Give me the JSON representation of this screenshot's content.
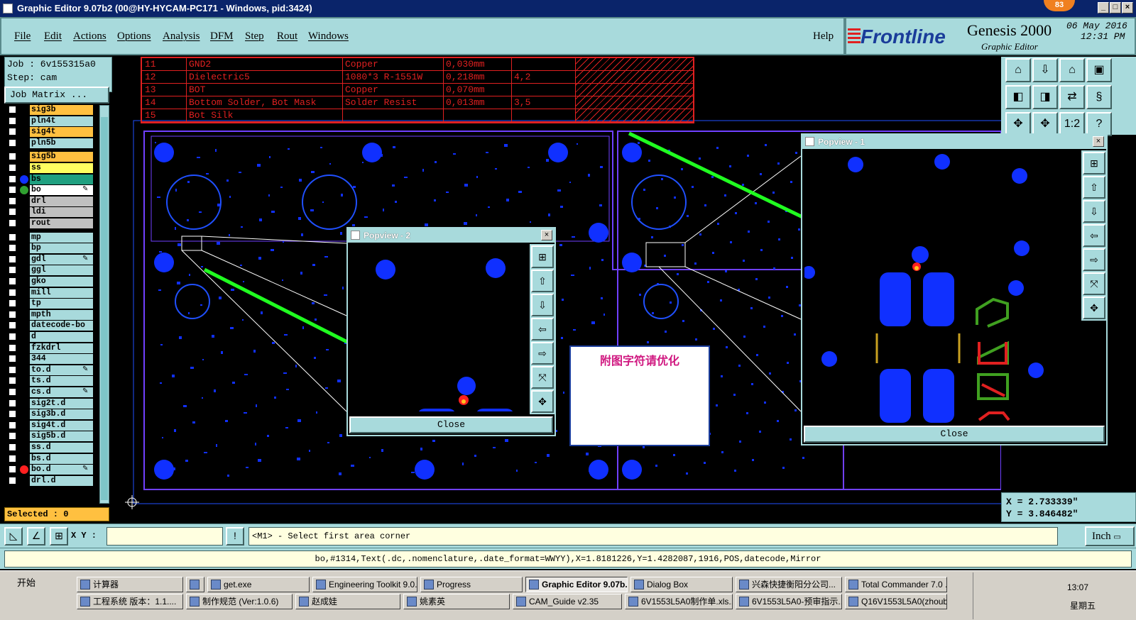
{
  "window": {
    "title": "Graphic Editor 9.07b2 (00@HY-HYCAM-PC171 - Windows, pid:3424)",
    "badge": "83",
    "min": "_",
    "max": "□",
    "close": "×"
  },
  "menu": {
    "items": [
      "File",
      "Edit",
      "Actions",
      "Options",
      "Analysis",
      "DFM",
      "Step",
      "Rout",
      "Windows"
    ],
    "help": "Help"
  },
  "brand": {
    "logo": "Frontline",
    "product": "Genesis 2000",
    "subtitle": "Graphic Editor",
    "date": "06 May 2016",
    "time": "12:31 PM"
  },
  "job": {
    "job_label": "Job : 6v155315a0",
    "step_label": "Step: cam",
    "matrix_button": "Job Matrix ..."
  },
  "layers": [
    {
      "name": "sig3b",
      "color": "#ffc040"
    },
    {
      "name": "pln4t",
      "color": "#a8dadc"
    },
    {
      "name": "sig4t",
      "color": "#ffc040"
    },
    {
      "name": "pln5b",
      "color": "#a8dadc"
    },
    {
      "name": "sig5b",
      "color": "#ffc040"
    },
    {
      "name": "ss",
      "color": "#ffff60"
    },
    {
      "name": "bs",
      "color": "#20a080",
      "dot": "#1030ff"
    },
    {
      "name": "bo",
      "color": "#ffffff",
      "dot": "#30a030",
      "mark": "✎"
    },
    {
      "name": "drl",
      "color": "#c0c0c0"
    },
    {
      "name": "ldi",
      "color": "#c0c0c0"
    },
    {
      "name": "rout",
      "color": "#c0c0c0"
    },
    {
      "name": "mp",
      "color": "#a8dadc"
    },
    {
      "name": "bp",
      "color": "#a8dadc"
    },
    {
      "name": "gdl",
      "color": "#a8dadc",
      "mark": "✎"
    },
    {
      "name": "ggl",
      "color": "#a8dadc"
    },
    {
      "name": "gko",
      "color": "#a8dadc"
    },
    {
      "name": "mill",
      "color": "#a8dadc"
    },
    {
      "name": "tp",
      "color": "#a8dadc"
    },
    {
      "name": "mpth",
      "color": "#a8dadc"
    },
    {
      "name": "datecode-bo",
      "color": "#a8dadc"
    },
    {
      "name": "d",
      "color": "#a8dadc"
    },
    {
      "name": "fzkdrl",
      "color": "#a8dadc"
    },
    {
      "name": "344",
      "color": "#a8dadc"
    },
    {
      "name": "to.d",
      "color": "#a8dadc",
      "mark": "✎"
    },
    {
      "name": "ts.d",
      "color": "#a8dadc"
    },
    {
      "name": "cs.d",
      "color": "#a8dadc",
      "mark": "✎"
    },
    {
      "name": "sig2t.d",
      "color": "#a8dadc"
    },
    {
      "name": "sig3b.d",
      "color": "#a8dadc"
    },
    {
      "name": "sig4t.d",
      "color": "#a8dadc"
    },
    {
      "name": "sig5b.d",
      "color": "#a8dadc"
    },
    {
      "name": "ss.d",
      "color": "#a8dadc"
    },
    {
      "name": "bs.d",
      "color": "#a8dadc"
    },
    {
      "name": "bo.d",
      "color": "#a8dadc",
      "dot": "#ff2020",
      "mark": "✎"
    },
    {
      "name": "drl.d",
      "color": "#a8dadc"
    }
  ],
  "selected": "Selected : 0",
  "stackup": {
    "rows": [
      [
        "11",
        "GND2",
        "Copper",
        "0,030mm",
        ""
      ],
      [
        "12",
        "Dielectric5",
        "1080*3 R-1551W",
        "0,218mm",
        "4,2"
      ],
      [
        "13",
        "BOT",
        "Copper",
        "0,070mm",
        ""
      ],
      [
        "14",
        "Bottom Solder, Bot Mask",
        "Solder Resist",
        "0,013mm",
        "3,5"
      ],
      [
        "15",
        "Bot Silk",
        "",
        "",
        ""
      ]
    ]
  },
  "popview2": {
    "title": "Popview - 2",
    "close_label": "Close"
  },
  "popview1": {
    "title": "Popview - 1",
    "close_label": "Close"
  },
  "note": {
    "text": "附图字符请优化"
  },
  "coords": {
    "x": "X = 2.733339\"",
    "y": "Y = 3.846482\""
  },
  "status": {
    "xy_label": "X Y :",
    "xy_value": "",
    "message": "<M1> - Select first area corner",
    "unit": "Inch"
  },
  "command": "bo,#1314,Text(.dc,.nomenclature,.date_format=WWYY),X=1.8181226,Y=1.4282087,1916,POS,datecode,Mirror",
  "taskbar": {
    "start": "开始",
    "row1": [
      "计算器",
      "",
      "get.exe",
      "Engineering Toolkit 9.0...",
      "Progress",
      "Graphic Editor 9.07b...",
      "Dialog Box",
      "兴森快捷衡阳分公司...",
      "Total Commander 7.0 ..."
    ],
    "row2": [
      "工程系统  版本：1.1....",
      "制作规范 (Ver:1.0.6)",
      "赵成娃",
      "姚素英",
      "CAM_Guide v2.35",
      "6V1553L5A0制作单.xls...",
      "6V1553L5A0-预审指示...",
      "Q16V1553L5A0(zhoub)..."
    ],
    "clock": "13:07",
    "weekday": "星期五"
  },
  "colors": {
    "accent": "#a8dadc",
    "pad_blue": "#1030ff",
    "arrow_green": "#20ff20",
    "stackup_red": "#e02020",
    "board_outline": "#8040ff"
  }
}
